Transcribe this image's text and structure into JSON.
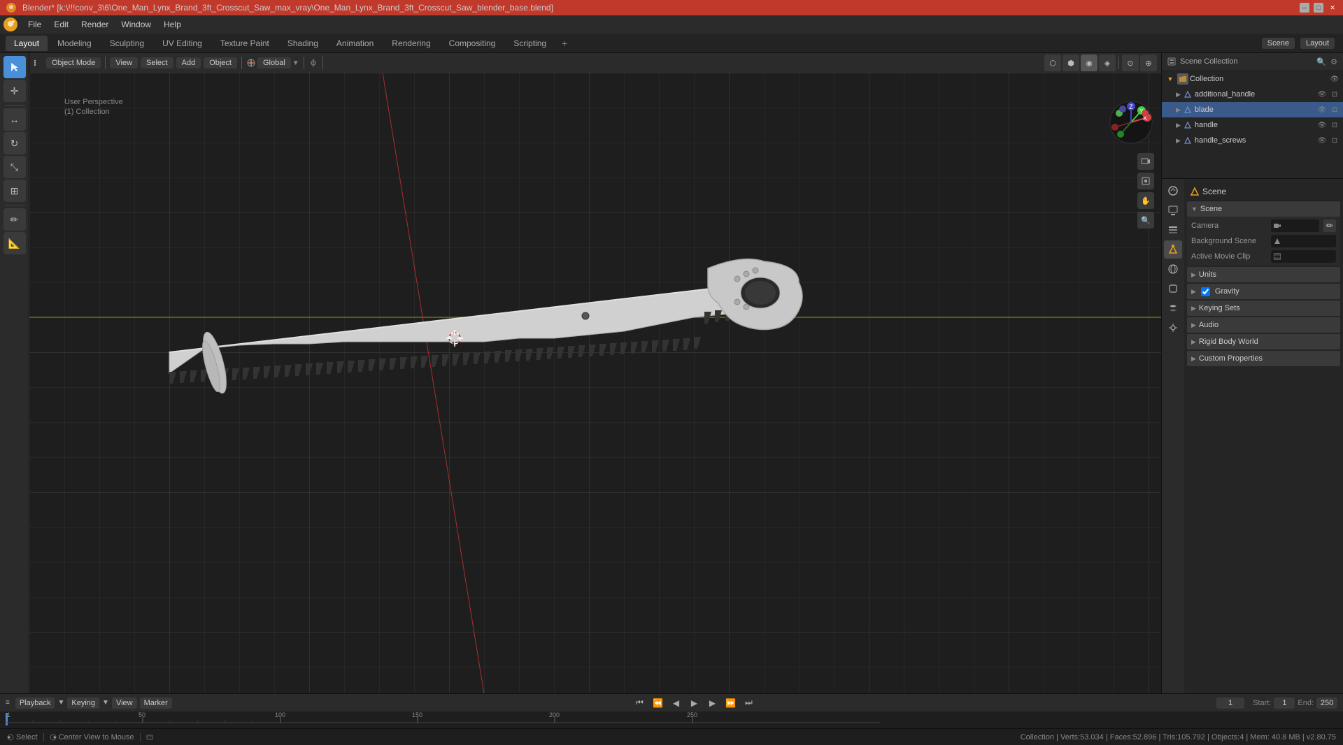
{
  "titlebar": {
    "title": "Blender* [k:\\!!!conv_3\\6\\One_Man_Lynx_Brand_3ft_Crosscut_Saw_max_vray\\One_Man_Lynx_Brand_3ft_Crosscut_Saw_blender_base.blend]",
    "controls": [
      "minimize",
      "maximize",
      "close"
    ]
  },
  "menubar": {
    "items": [
      "Blender",
      "File",
      "Edit",
      "Render",
      "Window",
      "Help"
    ]
  },
  "workspace_tabs": {
    "tabs": [
      "Layout",
      "Modeling",
      "Sculpting",
      "UV Editing",
      "Texture Paint",
      "Shading",
      "Animation",
      "Rendering",
      "Compositing",
      "Scripting"
    ],
    "active": "Layout",
    "add_label": "+"
  },
  "viewport": {
    "header": {
      "mode_label": "Object Mode",
      "view_label": "View",
      "select_label": "Select",
      "add_label": "Add",
      "object_label": "Object",
      "transform_label": "Global",
      "snap_label": "Snap"
    },
    "info": {
      "perspective": "User Perspective",
      "collection": "(1) Collection"
    },
    "gizmo": {
      "x_label": "X",
      "y_label": "Y",
      "z_label": "Z"
    }
  },
  "outliner": {
    "header_label": "Scene Collection",
    "items": [
      {
        "name": "Collection",
        "level": 0,
        "icon": "collection",
        "expanded": true
      },
      {
        "name": "additional_handle",
        "level": 1,
        "icon": "mesh"
      },
      {
        "name": "blade",
        "level": 1,
        "icon": "mesh"
      },
      {
        "name": "handle",
        "level": 1,
        "icon": "mesh"
      },
      {
        "name": "handle_screws",
        "level": 1,
        "icon": "mesh"
      }
    ]
  },
  "properties": {
    "active_tab": "scene",
    "tabs": [
      "render",
      "output",
      "view_layer",
      "scene",
      "world",
      "object",
      "modifier",
      "particles",
      "physics",
      "constraints",
      "data",
      "material"
    ],
    "scene_label": "Scene",
    "scene_name": "Scene",
    "rows": [
      {
        "label": "Camera",
        "value": ""
      },
      {
        "label": "Background Scene",
        "value": ""
      },
      {
        "label": "Active Movie Clip",
        "value": ""
      }
    ],
    "sections": [
      {
        "label": "Units",
        "expanded": false
      },
      {
        "label": "Gravity",
        "expanded": false,
        "has_checkbox": true,
        "checked": true
      },
      {
        "label": "Keying Sets",
        "expanded": false
      },
      {
        "label": "Audio",
        "expanded": false
      },
      {
        "label": "Rigid Body World",
        "expanded": false
      },
      {
        "label": "Custom Properties",
        "expanded": false
      }
    ]
  },
  "timeline": {
    "playback_label": "Playback",
    "keying_label": "Keying",
    "view_label": "View",
    "marker_label": "Marker",
    "start_label": "Start:",
    "start_value": "1",
    "end_label": "End:",
    "end_value": "250",
    "current_frame": "1",
    "frame_numbers": [
      1,
      50,
      100,
      150,
      200,
      250
    ]
  },
  "statusbar": {
    "select_label": "Select",
    "center_view_label": "Center View to Mouse",
    "stats": "Collection | Verts:53.034 | Faces:52.896 | Tris:105.792 | Objects:4 | Mem: 40.8 MB | v2.80.75"
  }
}
